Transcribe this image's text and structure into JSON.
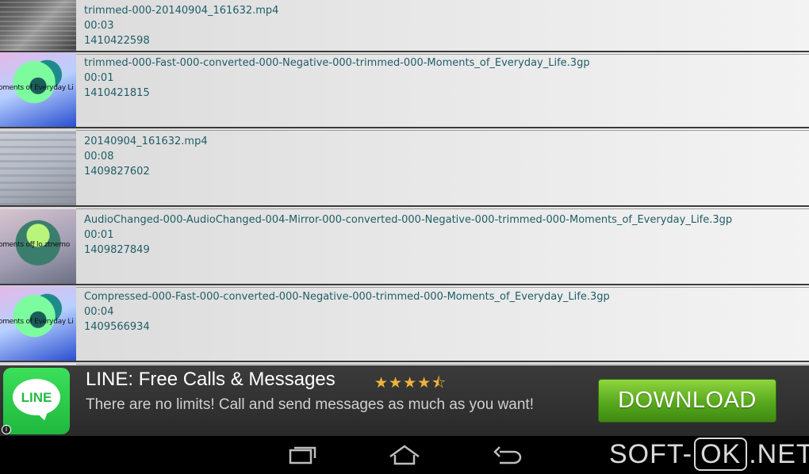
{
  "files": [
    {
      "name": "trimmed-000-20140904_161632.mp4",
      "duration": "00:03",
      "id": "1410422598",
      "thumb": "screen",
      "thumb_text": ""
    },
    {
      "name": "trimmed-000-Fast-000-converted-000-Negative-000-trimmed-000-Moments_of_Everyday_Life.3gp",
      "duration": "00:01",
      "id": "1410421815",
      "thumb": "art",
      "thumb_text": "oments of Everyday Li"
    },
    {
      "name": "20140904_161632.mp4",
      "duration": "00:08",
      "id": "1409827602",
      "thumb": "light",
      "thumb_text": ""
    },
    {
      "name": "AudioChanged-000-AudioChanged-004-Mirror-000-converted-000-Negative-000-trimmed-000-Moments_of_Everyday_Life.3gp",
      "duration": "00:01",
      "id": "1409827849",
      "thumb": "art2",
      "thumb_text": "oments ofƒ lo ztnemo"
    },
    {
      "name": "Compressed-000-Fast-000-converted-000-Negative-000-trimmed-000-Moments_of_Everyday_Life.3gp",
      "duration": "00:04",
      "id": "1409566934",
      "thumb": "art",
      "thumb_text": "oments of Everyday Li"
    }
  ],
  "ad": {
    "logo_text": "LINE",
    "title": "LINE: Free Calls & Messages",
    "rating_stars": "★★★★⯪",
    "rating": 4.5,
    "description": "There are no limits! Call and send messages as much as you want!",
    "button_label": "DOWNLOAD",
    "info_icon": "i",
    "colors": {
      "brand": "#1fb83e",
      "button": "#58a81d"
    }
  },
  "navbar": {
    "icons": [
      "recent-apps-icon",
      "home-icon",
      "back-icon"
    ]
  },
  "watermark": {
    "left": "SOFT-",
    "middle": "OK",
    "right": ".NET"
  }
}
